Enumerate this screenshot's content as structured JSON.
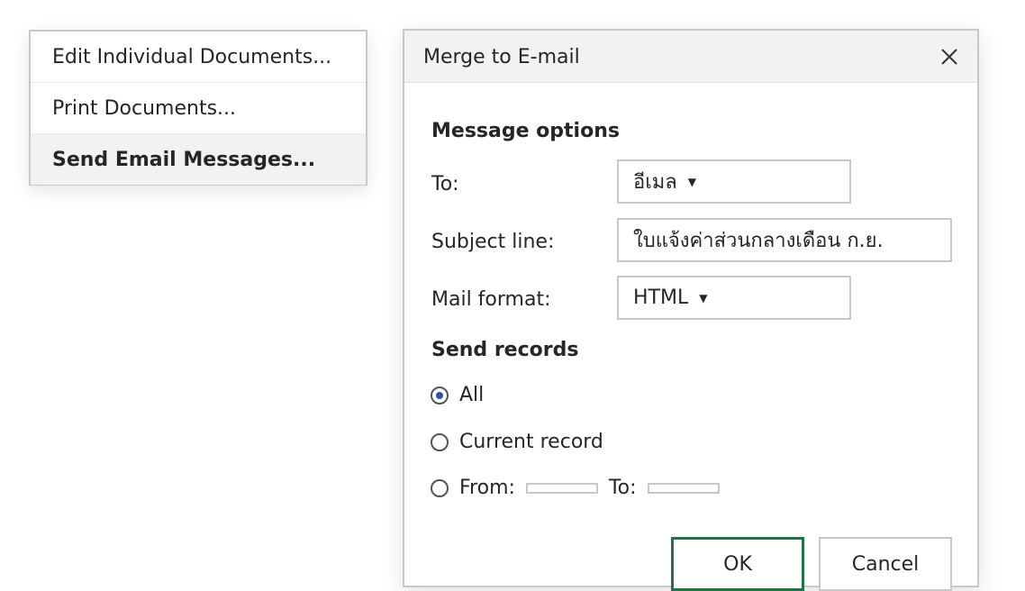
{
  "context_menu": {
    "items": [
      {
        "label": "Edit Individual Documents..."
      },
      {
        "label": "Print Documents..."
      },
      {
        "label": "Send Email Messages..."
      }
    ],
    "selected_index": 2
  },
  "dialog": {
    "title": "Merge to E-mail",
    "close_icon": "close-icon",
    "message_options": {
      "heading": "Message options",
      "to_label": "To:",
      "to_value": "อีเมล",
      "subject_label": "Subject line:",
      "subject_value": "ใบแจ้งค่าส่วนกลางเดือน ก.ย.",
      "format_label": "Mail format:",
      "format_value": "HTML"
    },
    "send_records": {
      "heading": "Send records",
      "options": [
        {
          "label": "All",
          "checked": true
        },
        {
          "label": "Current record",
          "checked": false
        },
        {
          "label": "From:",
          "checked": false
        }
      ],
      "from_value": "",
      "to_label": "To:",
      "to_value": ""
    },
    "ok_label": "OK",
    "cancel_label": "Cancel",
    "colors": {
      "ok_border": "#217346",
      "radio_accent": "#2b579a",
      "titlebar_bg": "#f3f2f1"
    }
  }
}
